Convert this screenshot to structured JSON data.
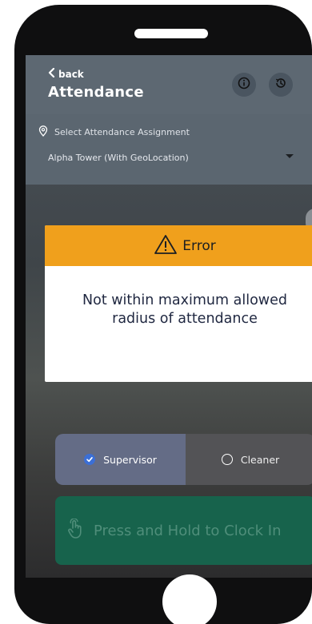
{
  "header": {
    "back_label": "back",
    "title": "Attendance",
    "info_icon": "info-circle-icon",
    "history_icon": "history-icon"
  },
  "assignment": {
    "label": "Select Attendance Assignment",
    "selected_value": "Alpha Tower (With GeoLocation)",
    "pin_icon": "location-pin-icon"
  },
  "error_dialog": {
    "title": "Error",
    "icon": "warning-triangle-icon",
    "message_line1": "Not within maximum allowed",
    "message_line2": "radius of attendance",
    "header_color": "#f0a01c"
  },
  "role_toggle": {
    "options": [
      {
        "label": "Supervisor",
        "selected": true
      },
      {
        "label": "Cleaner",
        "selected": false
      }
    ]
  },
  "clock_in": {
    "label": "Press and Hold to Clock In",
    "icon": "tap-hand-icon",
    "color": "#17634c"
  }
}
